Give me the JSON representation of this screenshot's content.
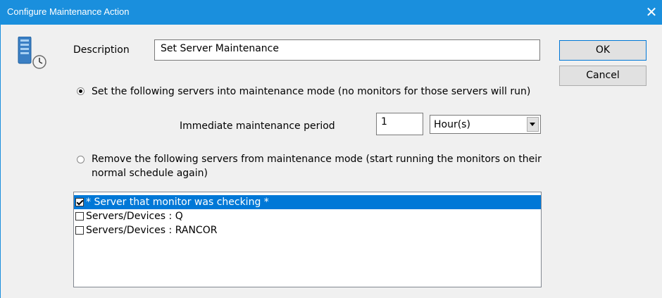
{
  "window": {
    "title": "Configure Maintenance Action",
    "close_glyph": "✕"
  },
  "form": {
    "description_label": "Description",
    "description_value": "Set Server Maintenance",
    "radio_set_label": "Set the following servers into maintenance mode (no monitors for those servers will run)",
    "radio_remove_label": "Remove the following servers from maintenance mode (start running the monitors on their normal schedule again)",
    "selected_mode": "set",
    "period_label": "Immediate maintenance period",
    "period_value": "1",
    "period_unit": "Hour(s)"
  },
  "buttons": {
    "ok": "OK",
    "cancel": "Cancel"
  },
  "servers": [
    {
      "label": "* Server that monitor was checking *",
      "checked": true,
      "selected": true
    },
    {
      "label": "Servers/Devices : Q",
      "checked": false,
      "selected": false
    },
    {
      "label": "Servers/Devices : RANCOR",
      "checked": false,
      "selected": false
    }
  ],
  "icons": {
    "dialog_icon": "server-clock-icon",
    "close": "close-icon",
    "dropdown": "chevron-down-icon"
  },
  "colors": {
    "titlebar": "#1a8fdd",
    "selection": "#0078d7"
  }
}
